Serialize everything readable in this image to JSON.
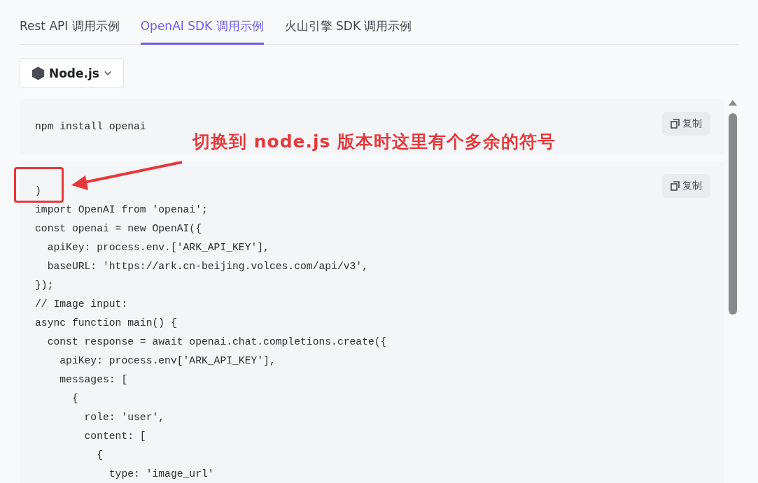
{
  "tabs": [
    {
      "label": "Rest API 调用示例",
      "selected": false
    },
    {
      "label": "OpenAI SDK 调用示例",
      "selected": true
    },
    {
      "label": "火山引擎 SDK 调用示例",
      "selected": false
    }
  ],
  "language_select": {
    "label": "Node.js"
  },
  "code_blocks": [
    {
      "copy_label": "复制",
      "lines": [
        "npm install openai"
      ]
    },
    {
      "copy_label": "复制",
      "lines": [
        ")",
        "import OpenAI from 'openai';",
        "const openai = new OpenAI({",
        "  apiKey: process.env.['ARK_API_KEY'],",
        "  baseURL: 'https://ark.cn-beijing.volces.com/api/v3',",
        "});",
        "// Image input:",
        "async function main() {",
        "  const response = await openai.chat.completions.create({",
        "    apiKey: process.env['ARK_API_KEY'],",
        "    messages: [",
        "      {",
        "        role: 'user',",
        "        content: [",
        "          {",
        "            type: 'image_url'"
      ]
    }
  ],
  "annotation": {
    "text": "切换到 node.js 版本时这里有个多余的符号"
  }
}
